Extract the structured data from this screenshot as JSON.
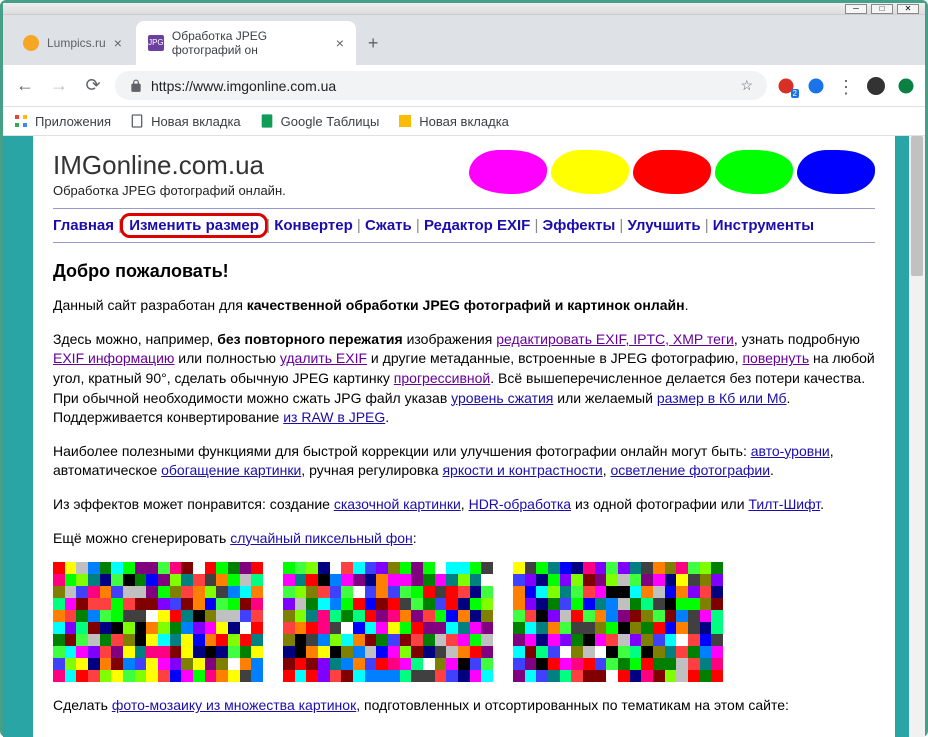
{
  "window": {
    "tabs": [
      {
        "title": "Lumpics.ru",
        "active": false,
        "favicon_color": "#f5a623"
      },
      {
        "title": "Обработка JPEG фотографий он",
        "active": true,
        "favicon_color": "#6b3fa0"
      }
    ],
    "url": "https://www.imgonline.com.ua"
  },
  "bookmarks": [
    {
      "label": "Приложения",
      "icon": "apps"
    },
    {
      "label": "Новая вкладка",
      "icon": "doc"
    },
    {
      "label": "Google Таблицы",
      "icon": "sheets"
    },
    {
      "label": "Новая вкладка",
      "icon": "icon4"
    }
  ],
  "toolbar_badge": "2",
  "site": {
    "title": "IMGonline.com.ua",
    "subtitle": "Обработка JPEG фотографий онлайн."
  },
  "blob_colors": [
    "#ff00ff",
    "#ffff00",
    "#ff0000",
    "#00ff00",
    "#0000ff"
  ],
  "nav": {
    "items": [
      "Главная",
      "Изменить размер",
      "Конвертер",
      "Сжать",
      "Редактор EXIF",
      "Эффекты",
      "Улучшить",
      "Инструменты"
    ],
    "highlighted_index": 1
  },
  "content": {
    "heading": "Добро пожаловать!",
    "p1_pre": "Данный сайт разработан для ",
    "p1_bold": "качественной обработки JPEG фотографий и картинок онлайн",
    "p1_post": ".",
    "p2_s1": "Здесь можно, например, ",
    "p2_b1": "без повторного пережатия",
    "p2_s2": " изображения ",
    "p2_a1": "редактировать EXIF, IPTC, XMP теги",
    "p2_s3": ", узнать подробную ",
    "p2_a2": "EXIF информацию",
    "p2_s4": " или полностью ",
    "p2_a3": "удалить EXIF",
    "p2_s5": " и другие метаданные, встроенные в JPEG фотографию, ",
    "p2_a4": "повернуть",
    "p2_s6": " на любой угол, кратный 90°, сделать обычную JPEG картинку ",
    "p2_a5": "прогрессивной",
    "p2_s7": ". Всё вышеперечисленное делается без потери качества. При обычной необходимости можно сжать JPG файл указав ",
    "p2_a6": "уровень сжатия",
    "p2_s8": " или желаемый ",
    "p2_a7": "размер в Кб или Мб",
    "p2_s9": ". Поддерживается конвертирование ",
    "p2_a8": "из RAW в JPEG",
    "p2_s10": ".",
    "p3_s1": "Наиболее полезными функциями для быстрой коррекции или улучшения фотографии онлайн могут быть: ",
    "p3_a1": "авто-уровни",
    "p3_s2": ", автоматическое ",
    "p3_a2": "обогащение картинки",
    "p3_s3": ", ручная регулировка ",
    "p3_a3": "яркости и контрастности",
    "p3_s4": ", ",
    "p3_a4": "осветление фотографии",
    "p3_s5": ".",
    "p4_s1": "Из эффектов может понравится: создание ",
    "p4_a1": "сказочной картинки",
    "p4_s2": ", ",
    "p4_a2": "HDR-обработка",
    "p4_s3": " из одной фотографии или ",
    "p4_a3": "Тилт-Шифт",
    "p4_s4": ".",
    "p5_s1": "Ещё можно сгенерировать ",
    "p5_a1": "случайный пиксельный фон",
    "p5_s2": ":",
    "p6_s1": "Сделать ",
    "p6_a1": "фото-мозаику из множества картинок",
    "p6_s2": ", подготовленных и отсортированных по тематикам на этом сайте:"
  }
}
